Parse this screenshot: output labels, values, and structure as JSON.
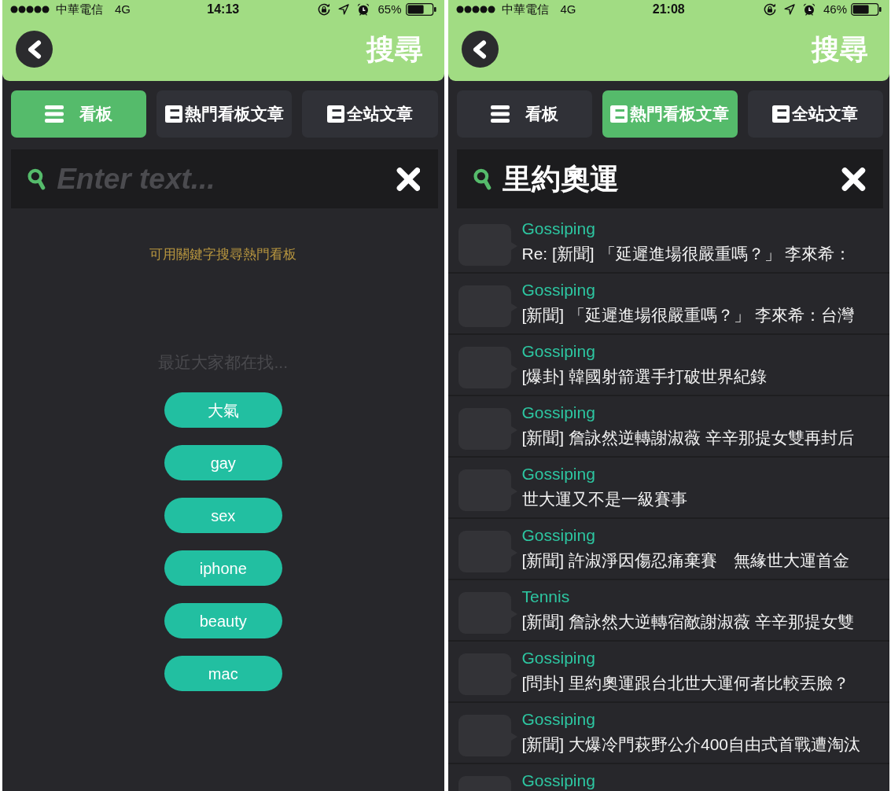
{
  "screens": [
    {
      "status_bar": {
        "carrier": "中華電信",
        "network": "4G",
        "time": "14:13",
        "battery": "65%"
      },
      "header": {
        "title": "搜尋"
      },
      "tabs": [
        {
          "kind": "boards",
          "label": "看板",
          "selected": true
        },
        {
          "kind": "articles",
          "label": "熱門看板文章",
          "selected": false
        },
        {
          "kind": "articles",
          "label": "全站文章",
          "selected": false
        }
      ],
      "search": {
        "placeholder": "Enter text..."
      },
      "suggestions": {
        "hint": "可用關鍵字搜尋熱門看板",
        "heading": "最近大家都在找...",
        "keywords": [
          "大氣",
          "gay",
          "sex",
          "iphone",
          "beauty",
          "mac"
        ]
      }
    },
    {
      "status_bar": {
        "carrier": "中華電信",
        "network": "4G",
        "time": "21:08",
        "battery": "46%"
      },
      "header": {
        "title": "搜尋"
      },
      "tabs": [
        {
          "kind": "boards",
          "label": "看板",
          "selected": false
        },
        {
          "kind": "articles",
          "label": "熱門看板文章",
          "selected": true
        },
        {
          "kind": "articles",
          "label": "全站文章",
          "selected": false
        }
      ],
      "search": {
        "value": "里約奧運"
      },
      "results": [
        {
          "board": "Gossiping",
          "title": "Re: [新聞] 「延遲進場很嚴重嗎？」 李來希："
        },
        {
          "board": "Gossiping",
          "title": "[新聞] 「延遲進場很嚴重嗎？」 李來希：台灣"
        },
        {
          "board": "Gossiping",
          "title": "[爆卦] 韓國射箭選手打破世界紀錄"
        },
        {
          "board": "Gossiping",
          "title": "[新聞] 詹詠然逆轉謝淑薇 辛辛那提女雙再封后"
        },
        {
          "board": "Gossiping",
          "title": "世大運又不是一級賽事"
        },
        {
          "board": "Gossiping",
          "title": "[新聞] 許淑淨因傷忍痛棄賽　無緣世大運首金"
        },
        {
          "board": "Tennis",
          "title": "[新聞] 詹詠然大逆轉宿敵謝淑薇 辛辛那提女雙"
        },
        {
          "board": "Gossiping",
          "title": "[問卦] 里約奧運跟台北世大運何者比較丟臉？"
        },
        {
          "board": "Gossiping",
          "title": "[新聞] 大爆冷門萩野公介400自由式首戰遭淘汰"
        },
        {
          "board": "Gossiping"
        }
      ]
    }
  ]
}
